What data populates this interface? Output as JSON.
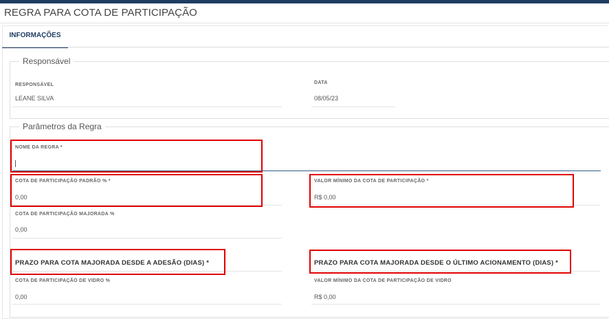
{
  "page": {
    "title": "REGRA PARA COTA DE PARTICIPAÇÃO"
  },
  "tabs": [
    {
      "label": "INFORMAÇÕES",
      "active": true
    }
  ],
  "responsavel_section": {
    "legend": "Responsável",
    "responsavel": {
      "label": "RESPONSÁVEL",
      "value": "LEANE SILVA"
    },
    "data": {
      "label": "DATA",
      "value": "08/05/23"
    }
  },
  "parametros_section": {
    "legend": "Parâmetros da Regra",
    "nome_regra": {
      "label": "NOME DA REGRA *",
      "value": ""
    },
    "cota_padrao": {
      "label": "COTA DE PARTICIPAÇÃO PADRÃO % *",
      "value": "0,00"
    },
    "valor_minimo": {
      "label": "VALOR MÍNIMO DA COTA DE PARTICIPAÇÃO *",
      "value": "R$ 0,00"
    },
    "cota_majorada": {
      "label": "COTA DE PARTICIPAÇÃO MAJORADA %",
      "value": "0,00"
    },
    "prazo_adesao": {
      "label": "PRAZO PARA COTA MAJORADA DESDE A ADESÃO (DIAS) *",
      "value": ""
    },
    "prazo_acionamento": {
      "label": "PRAZO PARA COTA MAJORADA DESDE O ÚLTIMO ACIONAMENTO (DIAS) *",
      "value": ""
    },
    "cota_vidro": {
      "label": "COTA DE PARTICIPAÇÃO DE VIDRO %",
      "value": "0,00"
    },
    "valor_minimo_vidro": {
      "label": "VALOR MÍNIMO DA COTA DE PARTICIPAÇÃO DE VIDRO",
      "value": "R$ 0,00"
    }
  },
  "colors": {
    "brand": "#1f3d63",
    "highlight": "#e00000",
    "active_line": "#2e5a86"
  }
}
